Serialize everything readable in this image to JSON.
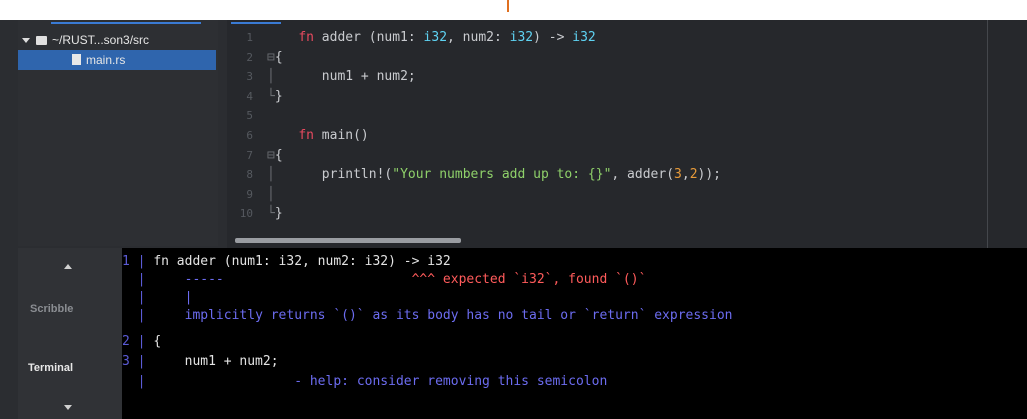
{
  "file_tree": {
    "folder_label": "~/RUST...son3/src",
    "file_label": "main.rs"
  },
  "editor": {
    "line_numbers": [
      "1",
      "2",
      "3",
      "4",
      "5",
      "6",
      "7",
      "8",
      "9",
      "10"
    ],
    "lines": {
      "l1_kw": "fn",
      "l1_a": " adder (num1: ",
      "l1_t1": "i32",
      "l1_b": ", num2: ",
      "l1_t2": "i32",
      "l1_c": ") -> ",
      "l1_t3": "i32",
      "l2": "{",
      "l3": "num1 + num2;",
      "l4": "}",
      "l6_kw": "fn",
      "l6_a": " main()",
      "l7": "{",
      "l8_a": "println!(",
      "l8_str": "\"Your numbers add up to: {}\"",
      "l8_b": ", adder(",
      "l8_n1": "3",
      "l8_c": ",",
      "l8_n2": "2",
      "l8_d": "));",
      "l10": "}"
    }
  },
  "side_tabs": {
    "scribble": "Scribble",
    "terminal": "Terminal"
  },
  "terminal": {
    "g1": "1 | ",
    "l1": "fn adder (num1: i32, num2: i32) -> i32",
    "g2": "  | ",
    "dashes": "-----",
    "carets": "^^^ expected `i32`, found `()`",
    "pipe": "|",
    "implicit": "implicitly returns `()` as its body has no tail or `return` expression",
    "g4": "2 | ",
    "brace": "{",
    "g5": "3 | ",
    "body": "    num1 + num2;",
    "help": "- help: consider removing this semicolon"
  }
}
